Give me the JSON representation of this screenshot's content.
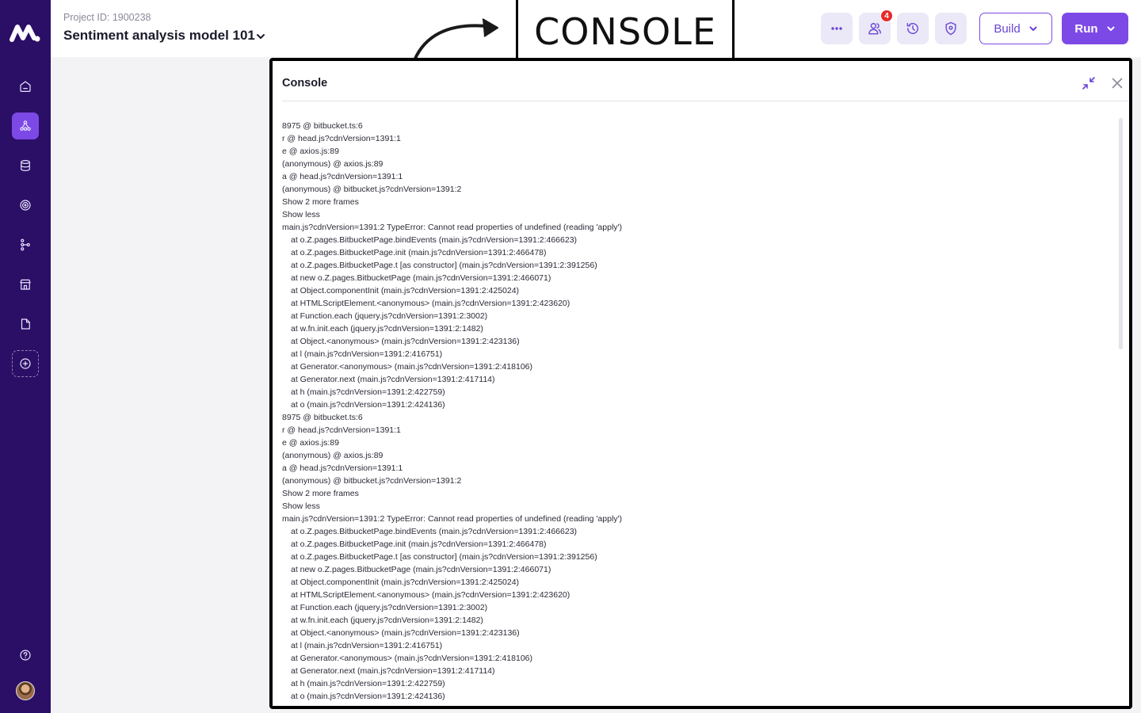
{
  "sidebar": {
    "items": [
      {
        "name": "home",
        "icon": "home-icon"
      },
      {
        "name": "pipeline",
        "icon": "nodes-icon",
        "active": true
      },
      {
        "name": "database",
        "icon": "database-icon"
      },
      {
        "name": "monitoring",
        "icon": "target-icon"
      },
      {
        "name": "workflow",
        "icon": "flow-icon"
      },
      {
        "name": "marketplace",
        "icon": "store-icon"
      },
      {
        "name": "files",
        "icon": "file-icon"
      },
      {
        "name": "add",
        "icon": "add-circle-icon"
      }
    ],
    "help_icon": "help-icon",
    "colors": {
      "background": "#2b0f66",
      "active": "#7d49e6"
    }
  },
  "header": {
    "project_id": "Project ID: 1900238",
    "project_title": "Sentiment analysis model 101",
    "notification_count": "4",
    "build_label": "Build",
    "run_label": "Run",
    "accent_color": "#7d49e6"
  },
  "annotation": {
    "label": "CONSOLE"
  },
  "console": {
    "title": "Console",
    "lines": [
      {
        "text": "8975 @ bitbucket.ts:6",
        "indent": false
      },
      {
        "text": "r @ head.js?cdnVersion=1391:1",
        "indent": false
      },
      {
        "text": "e @ axios.js:89",
        "indent": false
      },
      {
        "text": "(anonymous) @ axios.js:89",
        "indent": false
      },
      {
        "text": "a @ head.js?cdnVersion=1391:1",
        "indent": false
      },
      {
        "text": "(anonymous) @ bitbucket.js?cdnVersion=1391:2",
        "indent": false
      },
      {
        "text": "Show 2 more frames",
        "indent": false
      },
      {
        "text": "Show less",
        "indent": false
      },
      {
        "text": "main.js?cdnVersion=1391:2 TypeError: Cannot read properties of undefined (reading 'apply')",
        "indent": false
      },
      {
        "text": "at o.Z.pages.BitbucketPage.bindEvents (main.js?cdnVersion=1391:2:466623)",
        "indent": true
      },
      {
        "text": "at o.Z.pages.BitbucketPage.init (main.js?cdnVersion=1391:2:466478)",
        "indent": true
      },
      {
        "text": "at o.Z.pages.BitbucketPage.t [as constructor] (main.js?cdnVersion=1391:2:391256)",
        "indent": true
      },
      {
        "text": "at new o.Z.pages.BitbucketPage (main.js?cdnVersion=1391:2:466071)",
        "indent": true
      },
      {
        "text": "at Object.componentInit (main.js?cdnVersion=1391:2:425024)",
        "indent": true
      },
      {
        "text": "at HTMLScriptElement.<anonymous> (main.js?cdnVersion=1391:2:423620)",
        "indent": true
      },
      {
        "text": "at Function.each (jquery.js?cdnVersion=1391:2:3002)",
        "indent": true
      },
      {
        "text": "at w.fn.init.each (jquery.js?cdnVersion=1391:2:1482)",
        "indent": true
      },
      {
        "text": "at Object.<anonymous> (main.js?cdnVersion=1391:2:423136)",
        "indent": true
      },
      {
        "text": "at l (main.js?cdnVersion=1391:2:416751)",
        "indent": true
      },
      {
        "text": "at Generator.<anonymous> (main.js?cdnVersion=1391:2:418106)",
        "indent": true
      },
      {
        "text": "at Generator.next (main.js?cdnVersion=1391:2:417114)",
        "indent": true
      },
      {
        "text": "at h (main.js?cdnVersion=1391:2:422759)",
        "indent": true
      },
      {
        "text": "at o (main.js?cdnVersion=1391:2:424136)",
        "indent": true
      },
      {
        "text": "8975 @ bitbucket.ts:6",
        "indent": false
      },
      {
        "text": "r @ head.js?cdnVersion=1391:1",
        "indent": false
      },
      {
        "text": "e @ axios.js:89",
        "indent": false
      },
      {
        "text": "(anonymous) @ axios.js:89",
        "indent": false
      },
      {
        "text": "a @ head.js?cdnVersion=1391:1",
        "indent": false
      },
      {
        "text": "(anonymous) @ bitbucket.js?cdnVersion=1391:2",
        "indent": false
      },
      {
        "text": "Show 2 more frames",
        "indent": false
      },
      {
        "text": "Show less",
        "indent": false
      },
      {
        "text": "main.js?cdnVersion=1391:2 TypeError: Cannot read properties of undefined (reading 'apply')",
        "indent": false
      },
      {
        "text": "at o.Z.pages.BitbucketPage.bindEvents (main.js?cdnVersion=1391:2:466623)",
        "indent": true
      },
      {
        "text": "at o.Z.pages.BitbucketPage.init (main.js?cdnVersion=1391:2:466478)",
        "indent": true
      },
      {
        "text": "at o.Z.pages.BitbucketPage.t [as constructor] (main.js?cdnVersion=1391:2:391256)",
        "indent": true
      },
      {
        "text": "at new o.Z.pages.BitbucketPage (main.js?cdnVersion=1391:2:466071)",
        "indent": true
      },
      {
        "text": "at Object.componentInit (main.js?cdnVersion=1391:2:425024)",
        "indent": true
      },
      {
        "text": "at HTMLScriptElement.<anonymous> (main.js?cdnVersion=1391:2:423620)",
        "indent": true
      },
      {
        "text": "at Function.each (jquery.js?cdnVersion=1391:2:3002)",
        "indent": true
      },
      {
        "text": "at w.fn.init.each (jquery.js?cdnVersion=1391:2:1482)",
        "indent": true
      },
      {
        "text": "at Object.<anonymous> (main.js?cdnVersion=1391:2:423136)",
        "indent": true
      },
      {
        "text": "at l (main.js?cdnVersion=1391:2:416751)",
        "indent": true
      },
      {
        "text": "at Generator.<anonymous> (main.js?cdnVersion=1391:2:418106)",
        "indent": true
      },
      {
        "text": "at Generator.next (main.js?cdnVersion=1391:2:417114)",
        "indent": true
      },
      {
        "text": "at h (main.js?cdnVersion=1391:2:422759)",
        "indent": true
      },
      {
        "text": "at o (main.js?cdnVersion=1391:2:424136)",
        "indent": true
      }
    ]
  }
}
